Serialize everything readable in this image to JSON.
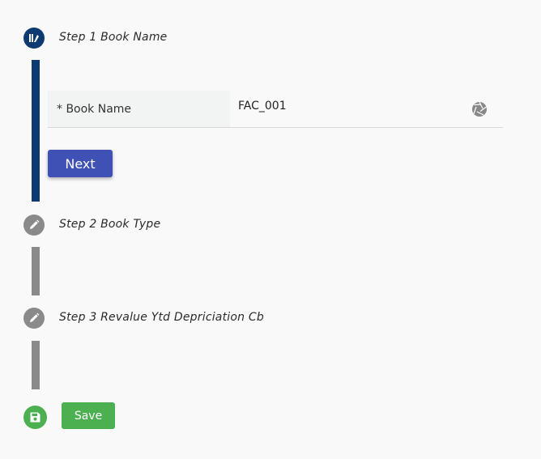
{
  "colors": {
    "active": "#0d3a70",
    "inactive": "#8a8a8a",
    "accent": "#3f51b5",
    "success": "#4caf50"
  },
  "steps": [
    {
      "title": "Step 1 Book Name",
      "state": "active",
      "icon": "step-active-icon"
    },
    {
      "title": "Step 2 Book Type",
      "state": "pending",
      "icon": "pencil-icon"
    },
    {
      "title": "Step 3 Revalue Ytd Depriciation Cb",
      "state": "pending",
      "icon": "pencil-icon"
    }
  ],
  "form": {
    "book_name_label": "* Book Name",
    "book_name_value": "FAC_001",
    "field_icon": "aperture-icon"
  },
  "buttons": {
    "next_label": "Next",
    "save_label": "Save",
    "save_icon": "save-icon"
  }
}
